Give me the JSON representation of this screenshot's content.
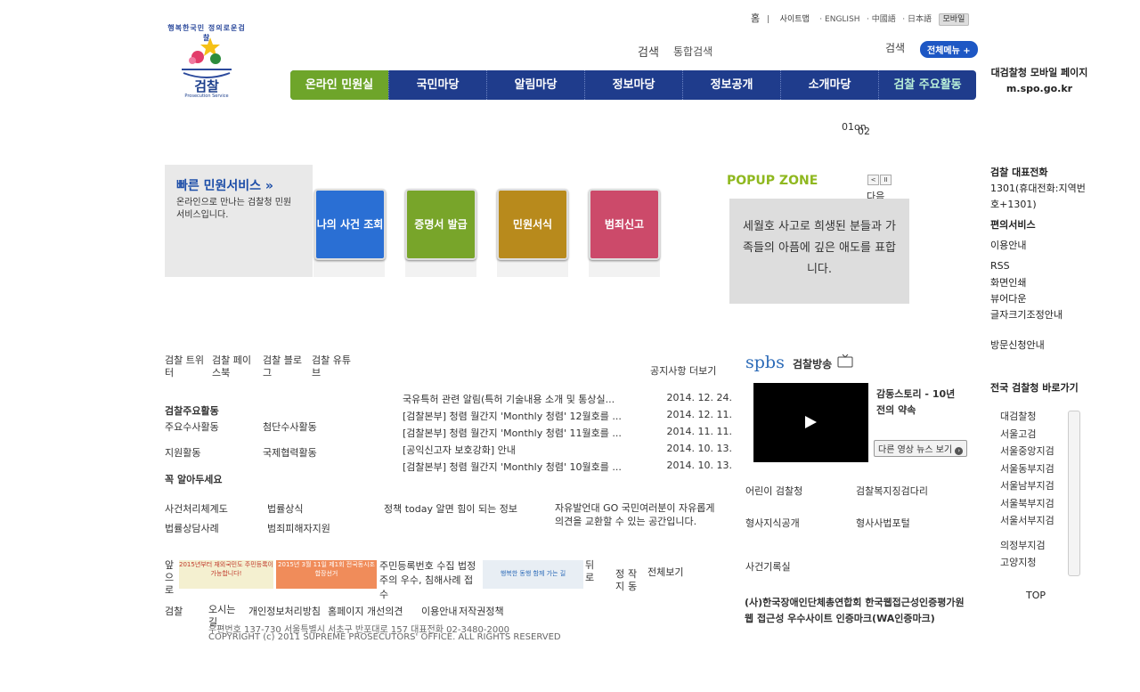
{
  "util": {
    "home": "홈",
    "sep": "|",
    "sitemap": "사이트맵",
    "english": "· ENGLISH",
    "chinese": "· 中國語",
    "japanese": "· 日本語",
    "mobile": "모바일"
  },
  "logo": {
    "slogan": "행복한국민 정의로운검찰",
    "name": "검찰",
    "sub": "Prosecution Service"
  },
  "search": {
    "label": "검색",
    "integrated": "통합검색",
    "right_label": "검색",
    "total_menu": "전체메뉴 +"
  },
  "nav": [
    "온라인 민원실",
    "국민마당",
    "알림마당",
    "정보마당",
    "정보공개",
    "소개마당",
    "검찰 주요활동"
  ],
  "mobile_page": "대검찰청 모바일 페이지 m.spo.go.kr",
  "rolling": {
    "a": "01on",
    "b": "02"
  },
  "quick": {
    "title": "빠른 민원서비스",
    "arrow": "»",
    "desc": "온라인으로 만나는 검찰청 민원 서비스입니다.",
    "buttons": [
      {
        "label": "나의 사건 조회",
        "color": "#2a6fd4"
      },
      {
        "label": "증명서 발급",
        "color": "#78a52a"
      },
      {
        "label": "민원서식",
        "color": "#b88a1c"
      },
      {
        "label": "범죄신고",
        "color": "#cc4a6a"
      }
    ]
  },
  "popup": {
    "title": "POPUP ZONE",
    "prev": "<",
    "pause": "II",
    "next": "다음",
    "image_text": "세월호 사고로 희생된 분들과 가족들의 아픔에 깊은 애도를 표합니다."
  },
  "side": {
    "phone_title": "검찰 대표전화",
    "phone": "1301(휴대전화:지역번호+1301)",
    "convenience": "편의서비스",
    "usage": "이용안내",
    "rss": "RSS",
    "print": "화면인쇄",
    "viewer": "뷰어다운",
    "fontsize": "글자크기조정안내",
    "visit": "방문신청안내",
    "orgs_title": "전국 검찰청 바로가기",
    "orgs": [
      "대검찰청",
      "서울고검",
      "서울중앙지검",
      "서울동부지검",
      "서울남부지검",
      "서울북부지검",
      "서울서부지검",
      "의정부지검",
      "고양지청"
    ],
    "top": "TOP"
  },
  "sns": {
    "twitter": "검찰 트위터",
    "facebook": "검찰 페이스북",
    "blog": "검찰 블로그",
    "youtube": "검찰 유튜브"
  },
  "notice": {
    "more": "공지사항 더보기",
    "items": [
      {
        "title": "국유특허 관련 알림(특허 기술내용 소개 및 통상실...",
        "date": "2014. 12. 24."
      },
      {
        "title": "[검찰본부] 청렴 월간지 'Monthly 청렴' 12월호를 ...",
        "date": "2014. 12. 11."
      },
      {
        "title": "[검찰본부] 청렴 월간지 'Monthly 청렴' 11월호를 ...",
        "date": "2014. 11. 11."
      },
      {
        "title": "[공익신고자 보호강화] 안내",
        "date": "2014. 10. 13."
      },
      {
        "title": "[검찰본부] 청렴 월간지 'Monthly 청렴' 10월호를 ...",
        "date": "2014. 10. 13."
      }
    ]
  },
  "activities": {
    "title": "검찰주요활동",
    "major": "주요수사활동",
    "advanced": "첨단수사활동",
    "support": "지원활동",
    "intl": "국제협력활동"
  },
  "must": {
    "title": "꼭 알아두세요",
    "procedure": "사건처리체계도",
    "law": "법률상식",
    "consult": "법률상담사례",
    "victim": "범죄피해자지원",
    "policy": "정책 today 알면 힘이 되는 정보",
    "go": "자유발언대 GO 국민여러분이 자유롭게 의견을 교환할 수 있는 공간입니다."
  },
  "spbs": {
    "logo": "spbs",
    "title": "검찰방송",
    "story": "감동스토리 - 10년 전의 약속",
    "more": "다른 영상 뉴스 보기"
  },
  "links": {
    "kids": "어린이 검찰청",
    "welfare": "검찰복지징검다리",
    "criminal": "형사지식공개",
    "portal": "형사사법포털",
    "record": "사건기록실"
  },
  "banners": {
    "prev": "앞으로",
    "b1": "2015년부터 재외국민도 주민등록이 가능합니다!",
    "b2": "2015년 3월 11일 제1회 전국동시조합장선거",
    "b3_text": "주민등록번호 수집 법정주의 우수, 침해사례 접수",
    "b4": "행복한 동행 함께 가는 길",
    "next": "뒤로",
    "stop": "정지",
    "auto": "작동",
    "all": "전체보기"
  },
  "footer": {
    "brand": "검찰",
    "directions": "오시는 길",
    "privacy": "개인정보처리방침",
    "feedback": "홈페이지 개선의견",
    "usage": "이용안내",
    "copyright_policy": "저작권정책",
    "address": "우편번호 137-730 서울특별시 서초구 반포대로 157 대표전화 02-3480-2000",
    "copyright": "COPYRIGHT (c) 2011 SUPREME PROSECUTORS' OFFICE. ALL RIGHTS RESERVED",
    "cert": "(사)한국장애인단체총연합회 한국웹접근성인증평가원 웹 접근성 우수사이트 인증마크(WA인증마크)"
  }
}
